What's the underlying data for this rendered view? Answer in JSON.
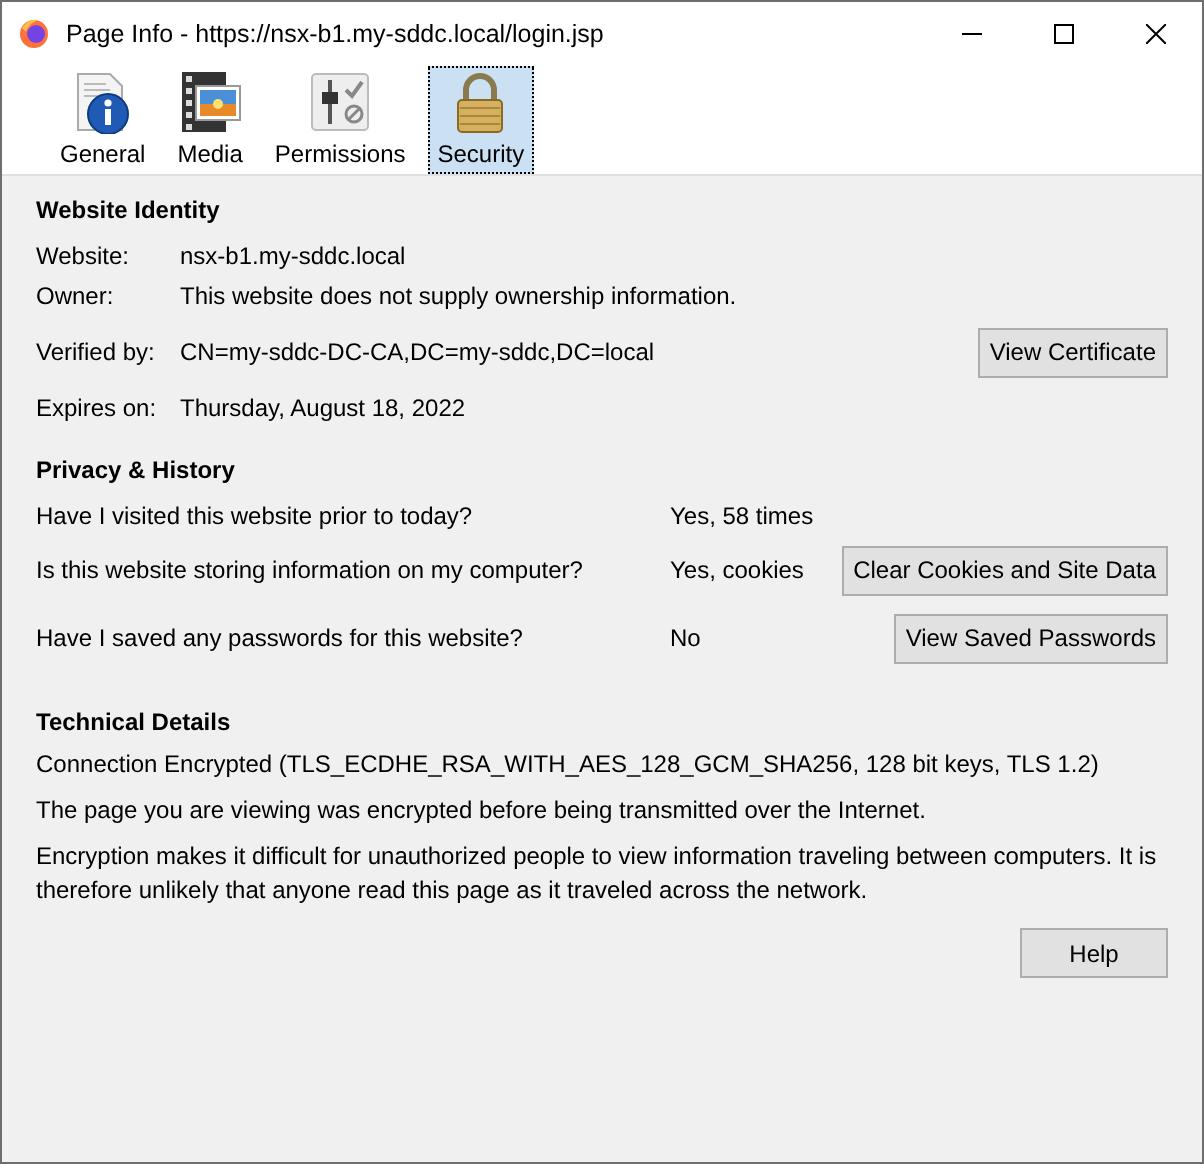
{
  "window": {
    "title": "Page Info - https://nsx-b1.my-sddc.local/login.jsp"
  },
  "tabs": [
    {
      "label": "General",
      "kind": "general",
      "selected": false
    },
    {
      "label": "Media",
      "kind": "media",
      "selected": false
    },
    {
      "label": "Permissions",
      "kind": "permissions",
      "selected": false
    },
    {
      "label": "Security",
      "kind": "security",
      "selected": true
    }
  ],
  "identity": {
    "heading": "Website Identity",
    "rows": [
      {
        "label": "Website:",
        "value": "nsx-b1.my-sddc.local"
      },
      {
        "label": "Owner:",
        "value": "This website does not supply ownership information."
      },
      {
        "label": "Verified by:",
        "value": "CN=my-sddc-DC-CA,DC=my-sddc,DC=local",
        "button": "View Certificate"
      },
      {
        "label": "Expires on:",
        "value": "Thursday, August 18, 2022"
      }
    ]
  },
  "privacy": {
    "heading": "Privacy & History",
    "rows": [
      {
        "question": "Have I visited this website prior to today?",
        "answer": "Yes, 58 times"
      },
      {
        "question": "Is this website storing information on my computer?",
        "answer": "Yes, cookies",
        "button": "Clear Cookies and Site Data"
      },
      {
        "question": "Have I saved any passwords for this website?",
        "answer": "No",
        "button": "View Saved Passwords"
      }
    ]
  },
  "technical": {
    "heading": "Technical Details",
    "lines": [
      "Connection Encrypted (TLS_ECDHE_RSA_WITH_AES_128_GCM_SHA256, 128 bit keys, TLS 1.2)",
      "The page you are viewing was encrypted before being transmitted over the Internet.",
      "Encryption makes it difficult for unauthorized people to view information traveling between computers. It is therefore unlikely that anyone read this page as it traveled across the network."
    ]
  },
  "help_button": "Help"
}
